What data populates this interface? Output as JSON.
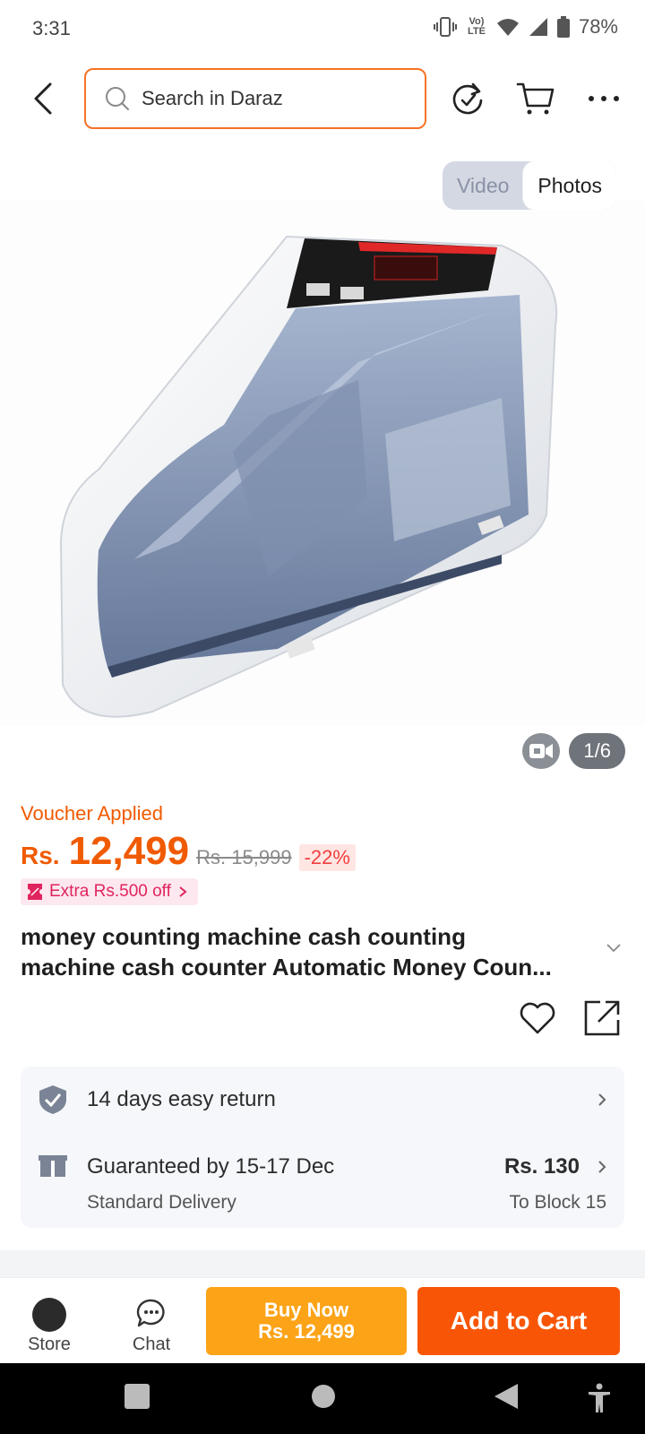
{
  "status_bar": {
    "time": "3:31",
    "network": "Vo) LTE",
    "battery": "78%"
  },
  "search": {
    "placeholder": "Search in Daraz"
  },
  "media_toggle": {
    "video": "Video",
    "photos": "Photos"
  },
  "gallery": {
    "counter": "1/6"
  },
  "product": {
    "voucher": "Voucher Applied",
    "currency": "Rs.",
    "price": "12,499",
    "original_price": "Rs. 15,999",
    "discount": "-22%",
    "extra_offer": "Extra Rs.500 off",
    "title_line1": "money counting machine cash counting",
    "title_line2": "machine cash counter Automatic Money Coun..."
  },
  "info": {
    "return_policy": "14 days easy return",
    "delivery_guarantee": "Guaranteed by 15-17 Dec",
    "delivery_type": "Standard Delivery",
    "delivery_price": "Rs. 130",
    "delivery_destination": "To Block 15"
  },
  "bottom_bar": {
    "store": "Store",
    "chat": "Chat",
    "buy_now": "Buy Now",
    "buy_now_price": "Rs. 12,499",
    "add_to_cart": "Add to Cart"
  },
  "colors": {
    "accent": "#f85606",
    "buy": "#fca317",
    "price": "#f05a00"
  }
}
